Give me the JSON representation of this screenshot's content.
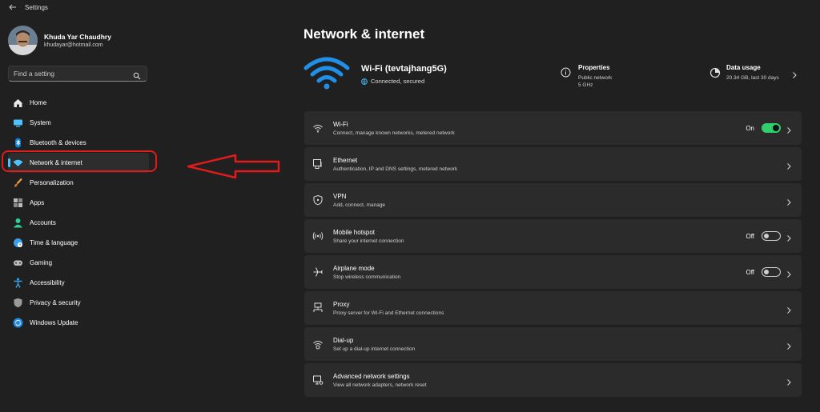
{
  "window": {
    "title": "Settings"
  },
  "user": {
    "name": "Khuda Yar Chaudhry",
    "email": "khudayar@hotmail.com"
  },
  "search": {
    "placeholder": "Find a setting"
  },
  "sidebar": {
    "items": [
      {
        "label": "Home",
        "icon": "home-icon",
        "selected": false
      },
      {
        "label": "System",
        "icon": "system-icon",
        "selected": false
      },
      {
        "label": "Bluetooth & devices",
        "icon": "bluetooth-icon",
        "selected": false
      },
      {
        "label": "Network & internet",
        "icon": "wifi-icon",
        "selected": true
      },
      {
        "label": "Personalization",
        "icon": "brush-icon",
        "selected": false
      },
      {
        "label": "Apps",
        "icon": "apps-icon",
        "selected": false
      },
      {
        "label": "Accounts",
        "icon": "accounts-icon",
        "selected": false
      },
      {
        "label": "Time & language",
        "icon": "globe-clock-icon",
        "selected": false
      },
      {
        "label": "Gaming",
        "icon": "gamepad-icon",
        "selected": false
      },
      {
        "label": "Accessibility",
        "icon": "accessibility-icon",
        "selected": false
      },
      {
        "label": "Privacy & security",
        "icon": "shield-icon",
        "selected": false
      },
      {
        "label": "Windows Update",
        "icon": "update-icon",
        "selected": false
      }
    ]
  },
  "main": {
    "title": "Network & internet",
    "connection": {
      "name": "Wi-Fi (tevtajhang5G)",
      "status": "Connected, secured"
    },
    "properties": {
      "title": "Properties",
      "line1": "Public network",
      "line2": "5 GHz"
    },
    "data_usage": {
      "title": "Data usage",
      "line1": "20.34 GB, last 30 days"
    },
    "cards": [
      {
        "title": "Wi-Fi",
        "subtitle": "Connect, manage known networks, metered network",
        "icon": "wifi-icon",
        "state": "On"
      },
      {
        "title": "Ethernet",
        "subtitle": "Authentication, IP and DNS settings, metered network",
        "icon": "ethernet-icon"
      },
      {
        "title": "VPN",
        "subtitle": "Add, connect, manage",
        "icon": "vpn-shield-icon"
      },
      {
        "title": "Mobile hotspot",
        "subtitle": "Share your internet connection",
        "icon": "hotspot-icon",
        "state": "Off"
      },
      {
        "title": "Airplane mode",
        "subtitle": "Stop wireless communication",
        "icon": "airplane-icon",
        "state": "Off"
      },
      {
        "title": "Proxy",
        "subtitle": "Proxy server for Wi-Fi and Ethernet connections",
        "icon": "proxy-icon"
      },
      {
        "title": "Dial-up",
        "subtitle": "Set up a dial-up internet connection",
        "icon": "dialup-icon"
      },
      {
        "title": "Advanced network settings",
        "subtitle": "View all network adapters, network reset",
        "icon": "advanced-network-icon"
      }
    ]
  },
  "colors": {
    "accent": "#4cc2ff",
    "toggle_on": "#2fcf6b",
    "annotation": "#e01b1b",
    "background": "#202020",
    "card": "#2b2b2b"
  }
}
